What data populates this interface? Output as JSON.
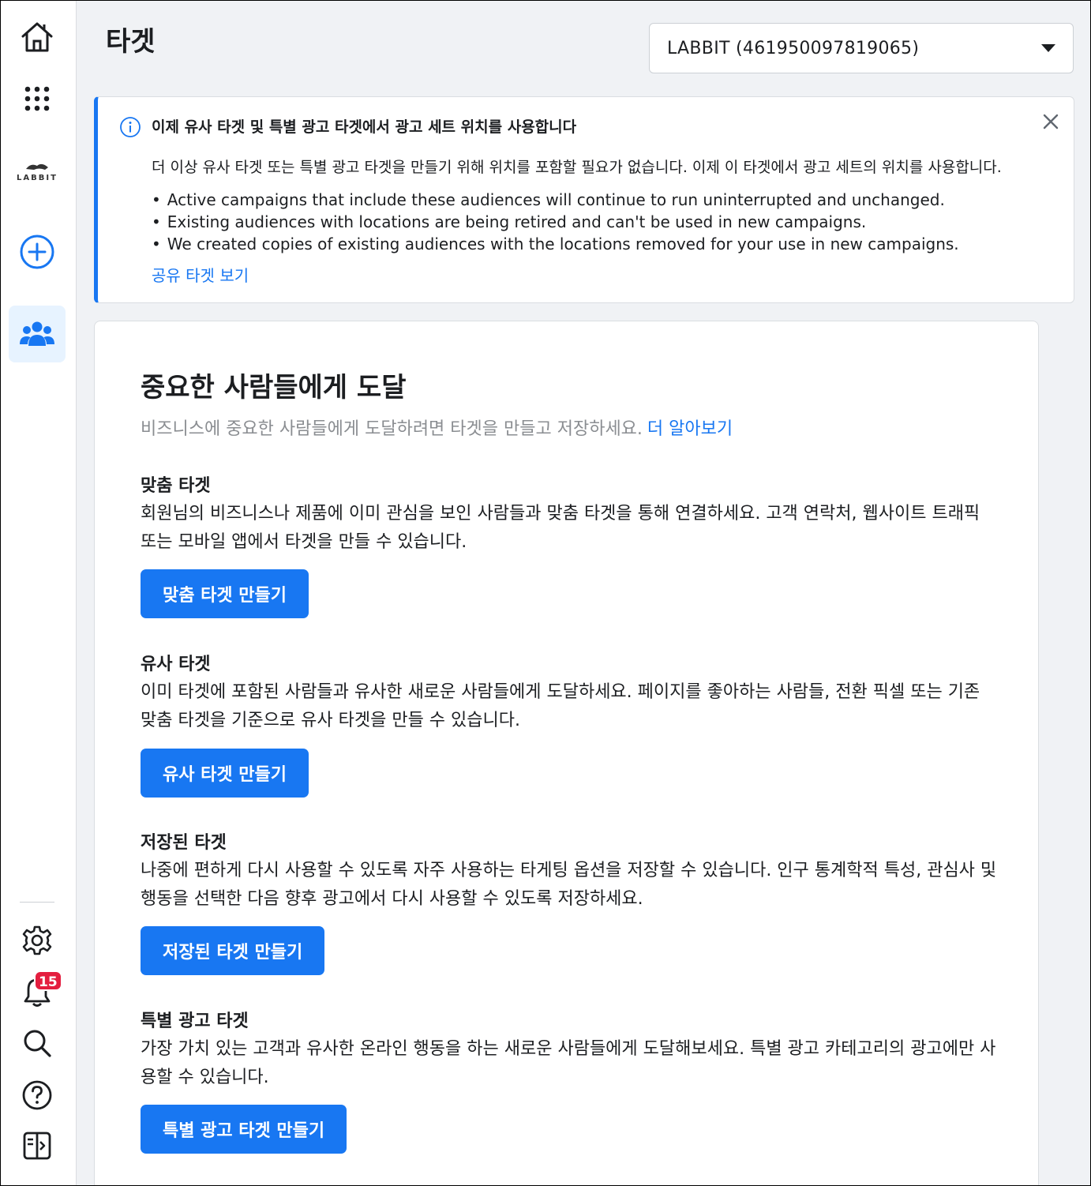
{
  "header": {
    "title": "타겟",
    "account_selector": "LABBIT (461950097819065)"
  },
  "sidebar": {
    "logo_text": "LABBIT",
    "notification_count": "15"
  },
  "notice": {
    "title": "이제 유사 타겟 및 특별 광고 타겟에서 광고 세트 위치를 사용합니다",
    "body": "더 이상 유사 타겟 또는 특별 광고 타겟을 만들기 위해 위치를 포함할 필요가 없습니다. 이제 이 타겟에서 광고 세트의 위치를 사용합니다.",
    "bullets": [
      "Active campaigns that include these audiences will continue to run uninterrupted and unchanged.",
      "Existing audiences with locations are being retired and can't be used in new campaigns.",
      "We created copies of existing audiences with the locations removed for your use in new campaigns."
    ],
    "link": "공유 타겟 보기"
  },
  "main": {
    "title": "중요한 사람들에게 도달",
    "subtitle": "비즈니스에 중요한 사람들에게 도달하려면 타겟을 만들고 저장하세요.",
    "learn_more": "더 알아보기",
    "sections": [
      {
        "title": "맞춤 타겟",
        "desc": "회원님의 비즈니스나 제품에 이미 관심을 보인 사람들과 맞춤 타겟을 통해 연결하세요. 고객 연락처, 웹사이트 트래픽 또는 모바일 앱에서 타겟을 만들 수 있습니다.",
        "button": "맞춤 타겟 만들기"
      },
      {
        "title": "유사 타겟",
        "desc": "이미 타겟에 포함된 사람들과 유사한 새로운 사람들에게 도달하세요. 페이지를 좋아하는 사람들, 전환 픽셀 또는 기존 맞춤 타겟을 기준으로 유사 타겟을 만들 수 있습니다.",
        "button": "유사 타겟 만들기"
      },
      {
        "title": "저장된 타겟",
        "desc": "나중에 편하게 다시 사용할 수 있도록 자주 사용하는 타게팅 옵션을 저장할 수 있습니다. 인구 통계학적 특성, 관심사 및 행동을 선택한 다음 향후 광고에서 다시 사용할 수 있도록 저장하세요.",
        "button": "저장된 타겟 만들기"
      },
      {
        "title": "특별 광고 타겟",
        "desc": "가장 가치 있는 고객과 유사한 온라인 행동을 하는 새로운 사람들에게 도달해보세요. 특별 광고 카테고리의 광고에만 사용할 수 있습니다.",
        "button": "특별 광고 타겟 만들기"
      }
    ]
  },
  "colors": {
    "accent": "#1877f2",
    "badge": "#e41e3f",
    "active_bg": "#e7f3ff"
  }
}
